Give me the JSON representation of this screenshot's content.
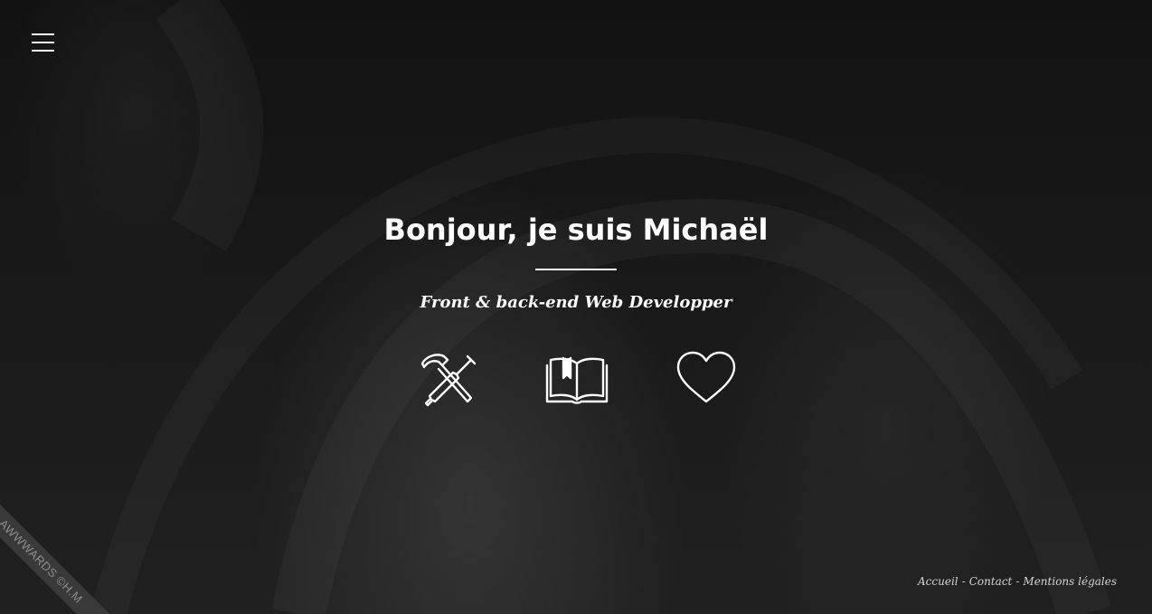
{
  "nav": {
    "menu_icon": "hamburger-menu-icon"
  },
  "hero": {
    "title": "Bonjour, je suis Michaël",
    "subtitle": "Front & back-end Web Developper"
  },
  "icons": [
    {
      "name": "tools-icon"
    },
    {
      "name": "book-icon"
    },
    {
      "name": "heart-icon"
    }
  ],
  "footer": {
    "links": [
      "Accueil",
      "Contact",
      "Mentions légales"
    ],
    "separator": "-"
  },
  "ribbon": {
    "label": "AWWWARDS ©H.M"
  },
  "colors": {
    "background": "#151515",
    "text": "#ffffff",
    "footer_text": "#d4d4d4",
    "ribbon": "#3a3a3a"
  }
}
